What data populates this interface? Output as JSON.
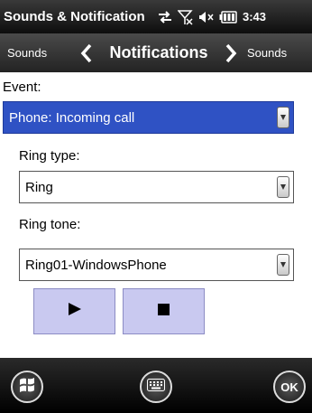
{
  "titlebar": {
    "title": "Sounds & Notification",
    "clock": "3:43",
    "icons": [
      "sync-arrows-icon",
      "no-signal-icon",
      "speaker-icon",
      "battery-icon"
    ]
  },
  "tabnav": {
    "prev_label": "Sounds",
    "current_label": "Notifications",
    "next_label": "Sounds"
  },
  "form": {
    "event_label": "Event:",
    "event_value": "Phone: Incoming call",
    "ring_type_label": "Ring type:",
    "ring_type_value": "Ring",
    "ring_tone_label": "Ring tone:",
    "ring_tone_value": "Ring01-WindowsPhone"
  },
  "controls": {
    "play_icon": "play-icon",
    "stop_icon": "stop-icon"
  },
  "bottombar": {
    "start_icon": "windows-start-icon",
    "keyboard_icon": "keyboard-icon",
    "ok_label": "OK"
  },
  "colors": {
    "selection": "#2f52c4",
    "button_fill": "#c9c9f0"
  }
}
